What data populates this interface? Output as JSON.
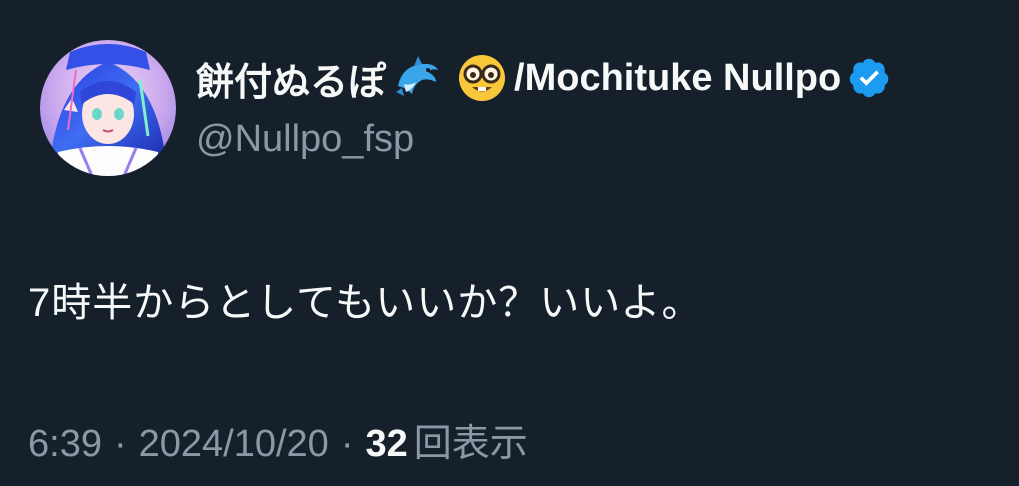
{
  "author": {
    "display_name": "餅付ぬるぽ",
    "name_suffix": "/Mochituke Nullpo",
    "handle": "@Nullpo_fsp",
    "emojis": [
      "dolphin-emoji",
      "nerd-face-emoji"
    ],
    "verified": true,
    "verified_color": "#1d9bf0"
  },
  "tweet": {
    "text": "7時半からとしてもいいか？いいよ。"
  },
  "meta": {
    "time": "6:39",
    "separator": "·",
    "date": "2024/10/20",
    "views_count": "32",
    "views_label": "回表示"
  },
  "colors": {
    "background": "#15202b",
    "primary_text": "#f7f9f9",
    "secondary_text": "#8b98a5"
  }
}
